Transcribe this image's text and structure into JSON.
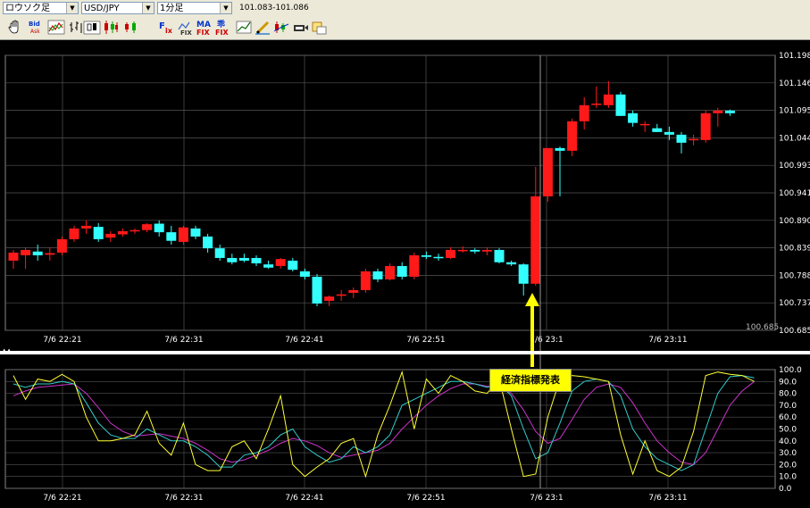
{
  "toolbar": {
    "chart_type": "ロウソク足",
    "symbol": "USD/JPY",
    "timeframe": "1分足",
    "price_range": "101.083-101.086",
    "buttons": [
      "hand-icon",
      "bid-ask-icon",
      "line-chart-icon",
      "bar-chart-icon",
      "candlestick-icon",
      "candle-small-icon",
      "fix-icon",
      "chart-fix-icon",
      "ma-fix-icon",
      "ichimoku-fix-icon",
      "trend-icon",
      "pen-icon",
      "indicator-icon",
      "export-icon",
      "settings-icon"
    ]
  },
  "annotation": {
    "text": "経済指標発表"
  },
  "colors": {
    "up": "#ff1a1a",
    "down": "#33ffff",
    "grid": "#555555",
    "k_line": "#ffff33",
    "d_line": "#33cccc",
    "slow_line": "#cc33cc"
  },
  "chart_data": {
    "type": "candlestick",
    "title": "USD/JPY 1分足",
    "y_axis_labels": [
      "101.198",
      "101.146",
      "101.095",
      "101.044",
      "100.993",
      "100.941",
      "100.890",
      "100.839",
      "100.788",
      "100.737",
      "100.685"
    ],
    "ylim": [
      100.685,
      101.198
    ],
    "last_price_label": "100.685",
    "x_tick_labels": [
      "7/6 22:21",
      "7/6 22:31",
      "7/6 22:41",
      "7/6 22:51",
      "7/6 23:1",
      "7/6 23:11"
    ],
    "candles": [
      {
        "o": 100.815,
        "h": 100.835,
        "l": 100.8,
        "c": 100.83
      },
      {
        "o": 100.825,
        "h": 100.84,
        "l": 100.8,
        "c": 100.835
      },
      {
        "o": 100.832,
        "h": 100.845,
        "l": 100.815,
        "c": 100.825
      },
      {
        "o": 100.826,
        "h": 100.84,
        "l": 100.815,
        "c": 100.829
      },
      {
        "o": 100.83,
        "h": 100.86,
        "l": 100.825,
        "c": 100.855
      },
      {
        "o": 100.855,
        "h": 100.88,
        "l": 100.85,
        "c": 100.875
      },
      {
        "o": 100.875,
        "h": 100.89,
        "l": 100.865,
        "c": 100.88
      },
      {
        "o": 100.878,
        "h": 100.885,
        "l": 100.85,
        "c": 100.855
      },
      {
        "o": 100.858,
        "h": 100.87,
        "l": 100.85,
        "c": 100.865
      },
      {
        "o": 100.864,
        "h": 100.875,
        "l": 100.86,
        "c": 100.87
      },
      {
        "o": 100.87,
        "h": 100.875,
        "l": 100.865,
        "c": 100.872
      },
      {
        "o": 100.872,
        "h": 100.885,
        "l": 100.868,
        "c": 100.883
      },
      {
        "o": 100.884,
        "h": 100.89,
        "l": 100.86,
        "c": 100.868
      },
      {
        "o": 100.868,
        "h": 100.88,
        "l": 100.845,
        "c": 100.852
      },
      {
        "o": 100.85,
        "h": 100.88,
        "l": 100.845,
        "c": 100.877
      },
      {
        "o": 100.875,
        "h": 100.88,
        "l": 100.855,
        "c": 100.86
      },
      {
        "o": 100.86,
        "h": 100.865,
        "l": 100.83,
        "c": 100.838
      },
      {
        "o": 100.838,
        "h": 100.845,
        "l": 100.815,
        "c": 100.82
      },
      {
        "o": 100.82,
        "h": 100.828,
        "l": 100.808,
        "c": 100.812
      },
      {
        "o": 100.82,
        "h": 100.828,
        "l": 100.812,
        "c": 100.815
      },
      {
        "o": 100.82,
        "h": 100.825,
        "l": 100.805,
        "c": 100.81
      },
      {
        "o": 100.808,
        "h": 100.815,
        "l": 100.8,
        "c": 100.802
      },
      {
        "o": 100.805,
        "h": 100.82,
        "l": 100.8,
        "c": 100.818
      },
      {
        "o": 100.815,
        "h": 100.82,
        "l": 100.795,
        "c": 100.798
      },
      {
        "o": 100.795,
        "h": 100.8,
        "l": 100.78,
        "c": 100.785
      },
      {
        "o": 100.785,
        "h": 100.79,
        "l": 100.73,
        "c": 100.735
      },
      {
        "o": 100.74,
        "h": 100.75,
        "l": 100.73,
        "c": 100.748
      },
      {
        "o": 100.75,
        "h": 100.76,
        "l": 100.74,
        "c": 100.752
      },
      {
        "o": 100.755,
        "h": 100.765,
        "l": 100.745,
        "c": 100.76
      },
      {
        "o": 100.76,
        "h": 100.8,
        "l": 100.755,
        "c": 100.795
      },
      {
        "o": 100.795,
        "h": 100.8,
        "l": 100.775,
        "c": 100.78
      },
      {
        "o": 100.78,
        "h": 100.81,
        "l": 100.778,
        "c": 100.805
      },
      {
        "o": 100.805,
        "h": 100.812,
        "l": 100.78,
        "c": 100.785
      },
      {
        "o": 100.785,
        "h": 100.83,
        "l": 100.78,
        "c": 100.825
      },
      {
        "o": 100.825,
        "h": 100.832,
        "l": 100.818,
        "c": 100.822
      },
      {
        "o": 100.822,
        "h": 100.828,
        "l": 100.815,
        "c": 100.82
      },
      {
        "o": 100.82,
        "h": 100.84,
        "l": 100.818,
        "c": 100.835
      },
      {
        "o": 100.835,
        "h": 100.842,
        "l": 100.83,
        "c": 100.835
      },
      {
        "o": 100.835,
        "h": 100.838,
        "l": 100.828,
        "c": 100.832
      },
      {
        "o": 100.832,
        "h": 100.84,
        "l": 100.825,
        "c": 100.835
      },
      {
        "o": 100.835,
        "h": 100.838,
        "l": 100.81,
        "c": 100.812
      },
      {
        "o": 100.812,
        "h": 100.815,
        "l": 100.805,
        "c": 100.808
      },
      {
        "o": 100.808,
        "h": 100.81,
        "l": 100.75,
        "c": 100.772
      },
      {
        "o": 100.772,
        "h": 100.99,
        "l": 100.768,
        "c": 100.935
      },
      {
        "o": 100.935,
        "h": 101.025,
        "l": 100.925,
        "c": 101.025
      },
      {
        "o": 101.025,
        "h": 101.028,
        "l": 100.935,
        "c": 101.02
      },
      {
        "o": 101.02,
        "h": 101.08,
        "l": 101.01,
        "c": 101.075
      },
      {
        "o": 101.075,
        "h": 101.12,
        "l": 101.06,
        "c": 101.105
      },
      {
        "o": 101.108,
        "h": 101.14,
        "l": 101.1,
        "c": 101.108
      },
      {
        "o": 101.105,
        "h": 101.15,
        "l": 101.1,
        "c": 101.125
      },
      {
        "o": 101.125,
        "h": 101.13,
        "l": 101.085,
        "c": 101.085
      },
      {
        "o": 101.09,
        "h": 101.095,
        "l": 101.065,
        "c": 101.072
      },
      {
        "o": 101.07,
        "h": 101.075,
        "l": 101.055,
        "c": 101.07
      },
      {
        "o": 101.062,
        "h": 101.07,
        "l": 101.055,
        "c": 101.055
      },
      {
        "o": 101.055,
        "h": 101.065,
        "l": 101.04,
        "c": 101.05
      },
      {
        "o": 101.05,
        "h": 101.055,
        "l": 101.015,
        "c": 101.035
      },
      {
        "o": 101.04,
        "h": 101.05,
        "l": 101.03,
        "c": 101.042
      },
      {
        "o": 101.04,
        "h": 101.095,
        "l": 101.035,
        "c": 101.09
      },
      {
        "o": 101.09,
        "h": 101.1,
        "l": 101.065,
        "c": 101.095
      },
      {
        "o": 101.095,
        "h": 101.097,
        "l": 101.085,
        "c": 101.09
      }
    ],
    "stochastics": {
      "y_axis_labels": [
        "100.0",
        "90.0",
        "80.0",
        "70.0",
        "60.0",
        "50.0",
        "40.0",
        "30.0",
        "20.0",
        "10.0",
        "0.0"
      ],
      "ylim": [
        0,
        100
      ],
      "k": [
        95,
        75,
        92,
        90,
        96,
        90,
        60,
        40,
        40,
        42,
        45,
        65,
        38,
        28,
        55,
        20,
        15,
        15,
        35,
        40,
        25,
        50,
        78,
        20,
        10,
        18,
        25,
        38,
        42,
        10,
        45,
        70,
        98,
        50,
        92,
        80,
        95,
        90,
        82,
        80,
        92,
        50,
        10,
        12,
        60,
        92,
        95,
        94,
        92,
        90,
        45,
        12,
        40,
        15,
        10,
        18,
        48,
        95,
        98,
        96,
        95,
        90
      ],
      "d": [
        88,
        85,
        88,
        88,
        90,
        88,
        72,
        55,
        45,
        42,
        42,
        50,
        45,
        40,
        40,
        35,
        28,
        18,
        18,
        28,
        30,
        35,
        45,
        50,
        35,
        28,
        22,
        25,
        35,
        30,
        35,
        45,
        70,
        75,
        80,
        85,
        90,
        90,
        88,
        85,
        88,
        78,
        50,
        25,
        30,
        55,
        82,
        90,
        92,
        90,
        78,
        50,
        35,
        25,
        20,
        15,
        20,
        50,
        80,
        94,
        95,
        93
      ],
      "slow": [
        78,
        82,
        85,
        86,
        87,
        88,
        80,
        68,
        55,
        48,
        44,
        45,
        46,
        44,
        42,
        38,
        32,
        25,
        22,
        24,
        28,
        32,
        38,
        42,
        40,
        36,
        30,
        26,
        28,
        30,
        32,
        38,
        50,
        60,
        70,
        78,
        84,
        88,
        88,
        86,
        86,
        80,
        66,
        48,
        38,
        42,
        58,
        75,
        85,
        88,
        85,
        72,
        55,
        40,
        30,
        22,
        20,
        30,
        50,
        70,
        82,
        90
      ]
    }
  }
}
